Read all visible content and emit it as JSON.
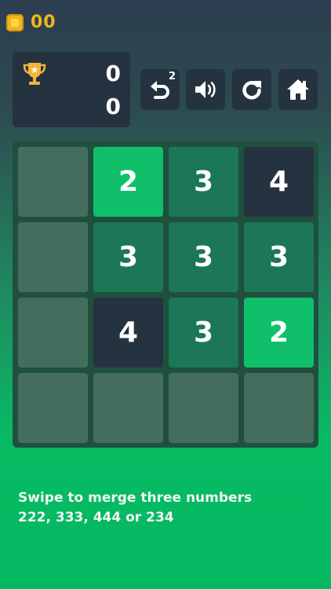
{
  "coins": {
    "count": "00",
    "icon": "coin-icon"
  },
  "score": {
    "current": "0",
    "best": "0",
    "icon": "trophy-icon"
  },
  "toolbar": {
    "undo": {
      "icon": "undo-icon",
      "remaining": "2"
    },
    "sound": {
      "icon": "speaker-icon"
    },
    "restart": {
      "icon": "restart-icon"
    },
    "home": {
      "icon": "home-icon"
    }
  },
  "board": {
    "rows": [
      [
        "",
        "2",
        "3",
        "4"
      ],
      [
        "",
        "3",
        "3",
        "3"
      ],
      [
        "",
        "4",
        "3",
        "2"
      ],
      [
        "",
        "",
        "",
        ""
      ]
    ]
  },
  "instructions": {
    "line1": "Swipe to merge three numbers",
    "line2": "222, 333, 444 or 234"
  },
  "colors": {
    "tile_2": "#0fbf6a",
    "tile_3": "#1c7756",
    "tile_4": "#253240",
    "coin": "#f2b51c",
    "trophy": "#f0b53a"
  }
}
